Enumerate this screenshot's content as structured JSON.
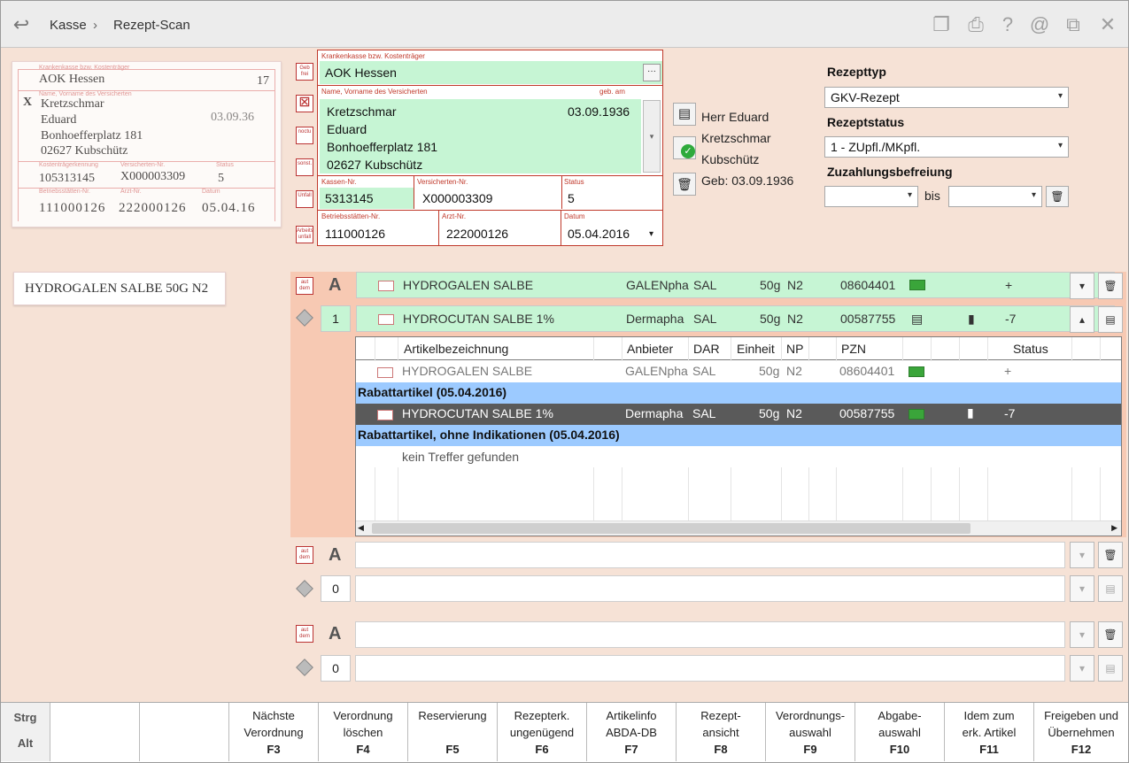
{
  "header": {
    "breadcrumb_root": "Kasse",
    "breadcrumb_sep": "›",
    "breadcrumb_current": "Rezept-Scan"
  },
  "scan": {
    "kasse": "AOK Hessen",
    "kasse_num": "17",
    "mark": "X",
    "name1": "Kretzschmar",
    "name2": "Eduard",
    "strasse": "Bonhoefferplatz 181",
    "ort": "02627 Kubschütz",
    "gebdat": "03.09.36",
    "kassennr": "105313145",
    "versnr": "X000003309",
    "status": "5",
    "bsnr": "111000126",
    "arztnr": "222000126",
    "datum": "05.04.16",
    "lbl_kasse": "Krankenkasse bzw. Kostenträger",
    "lbl_name": "Name, Vorname des Versicherten",
    "lbl_kassennr": "Kostenträgerkennung",
    "lbl_versnr": "Versicherten-Nr.",
    "lbl_status": "Status",
    "lbl_bsnr": "Betriebsstätten-Nr.",
    "lbl_arztnr": "Arzt-Nr.",
    "lbl_datum": "Datum",
    "article_card": "HYDROGALEN SALBE 50G N2"
  },
  "side_buttons": [
    "Geb frei",
    "noctu",
    "sonst.",
    "Unfall",
    "Arbeits unfall"
  ],
  "form": {
    "kasse_label": "Krankenkasse bzw. Kostenträger",
    "kasse_value": "AOK Hessen",
    "kasse_btn": "···",
    "name_label": "Name, Vorname des Versicherten",
    "gebam_label": "geb. am",
    "name_line1": "Kretzschmar",
    "name_line2": "Eduard",
    "name_line3": "Bonhoefferplatz 181",
    "name_line4": "02627 Kubschütz",
    "geb_value": "03.09.1936",
    "kassennr_label": "Kassen-Nr.",
    "kassennr_value": "5313145",
    "versnr_label": "Versicherten-Nr.",
    "versnr_value": "X000003309",
    "status_label": "Status",
    "status_value": "5",
    "bsnr_label": "Betriebsstätten-Nr.",
    "bsnr_value": "111000126",
    "arztnr_label": "Arzt-Nr.",
    "arztnr_value": "222000126",
    "datum_label": "Datum",
    "datum_value": "05.04.2016"
  },
  "patient": {
    "line1": "Herr Eduard",
    "line2": "Kretzschmar",
    "line3": "Kubschütz",
    "line4": "Geb: 03.09.1936"
  },
  "right": {
    "rezepttyp_label": "Rezepttyp",
    "rezepttyp_value": "GKV-Rezept",
    "rezeptstatus_label": "Rezeptstatus",
    "rezeptstatus_value": "1 - ZUpfl./MKpfl.",
    "zuzahlung_label": "Zuzahlungsbefreiung",
    "bis": "bis"
  },
  "verordnung": {
    "aut_dem": "aut dem",
    "A": "A",
    "row1": {
      "name": "HYDROGALEN SALBE",
      "anbieter": "GALENpha",
      "dar": "SAL",
      "einheit": "50g",
      "np": "N2",
      "pzn": "08604401",
      "status": "+"
    },
    "row2_count": "1",
    "row2": {
      "name": "HYDROCUTAN SALBE 1%",
      "anbieter": "Dermapha",
      "dar": "SAL",
      "einheit": "50g",
      "np": "N2",
      "pzn": "00587755",
      "status": "-7"
    }
  },
  "grid": {
    "headers": {
      "artikel": "Artikelbezeichnung",
      "anbieter": "Anbieter",
      "dar": "DAR",
      "einheit": "Einheit",
      "np": "NP",
      "pzn": "PZN",
      "status": "Status"
    },
    "rowA": {
      "name": "HYDROGALEN SALBE",
      "anbieter": "GALENpha",
      "dar": "SAL",
      "einheit": "50g",
      "np": "N2",
      "pzn": "08604401",
      "status": "+"
    },
    "section1": "Rabattartikel (05.04.2016)",
    "rowB": {
      "name": "HYDROCUTAN SALBE 1%",
      "anbieter": "Dermapha",
      "dar": "SAL",
      "einheit": "50g",
      "np": "N2",
      "pzn": "00587755",
      "status": "-7"
    },
    "section2": "Rabattartikel, ohne Indikationen (05.04.2016)",
    "none": "kein Treffer gefunden"
  },
  "empty_rows": {
    "count_a": "0",
    "count_b": "0"
  },
  "fkeys": {
    "strg": "Strg",
    "alt": "Alt",
    "f3_label": "Nächste Verordnung",
    "f3": "F3",
    "f4_label": "Verordnung löschen",
    "f4": "F4",
    "f5_label": "Reservierung",
    "f5": "F5",
    "f6_label": "Rezepterk. ungenügend",
    "f6": "F6",
    "f7_label": "Artikelinfo ABDA-DB",
    "f7": "F7",
    "f8_label": "Rezept-ansicht",
    "f8": "F8",
    "f9_label": "Verordnungs-auswahl",
    "f9": "F9",
    "f10_label": "Abgabe-auswahl",
    "f10": "F10",
    "f11_label": "Idem zum erk. Artikel",
    "f11": "F11",
    "f12_label": "Freigeben und Übernehmen",
    "f12": "F12"
  },
  "colors": {
    "accent_red": "#c0392b",
    "green_field": "#c6f5d4",
    "section_blue": "#9ccaff",
    "selected_row": "#5a5a5a",
    "bg": "#f6e2d6"
  }
}
